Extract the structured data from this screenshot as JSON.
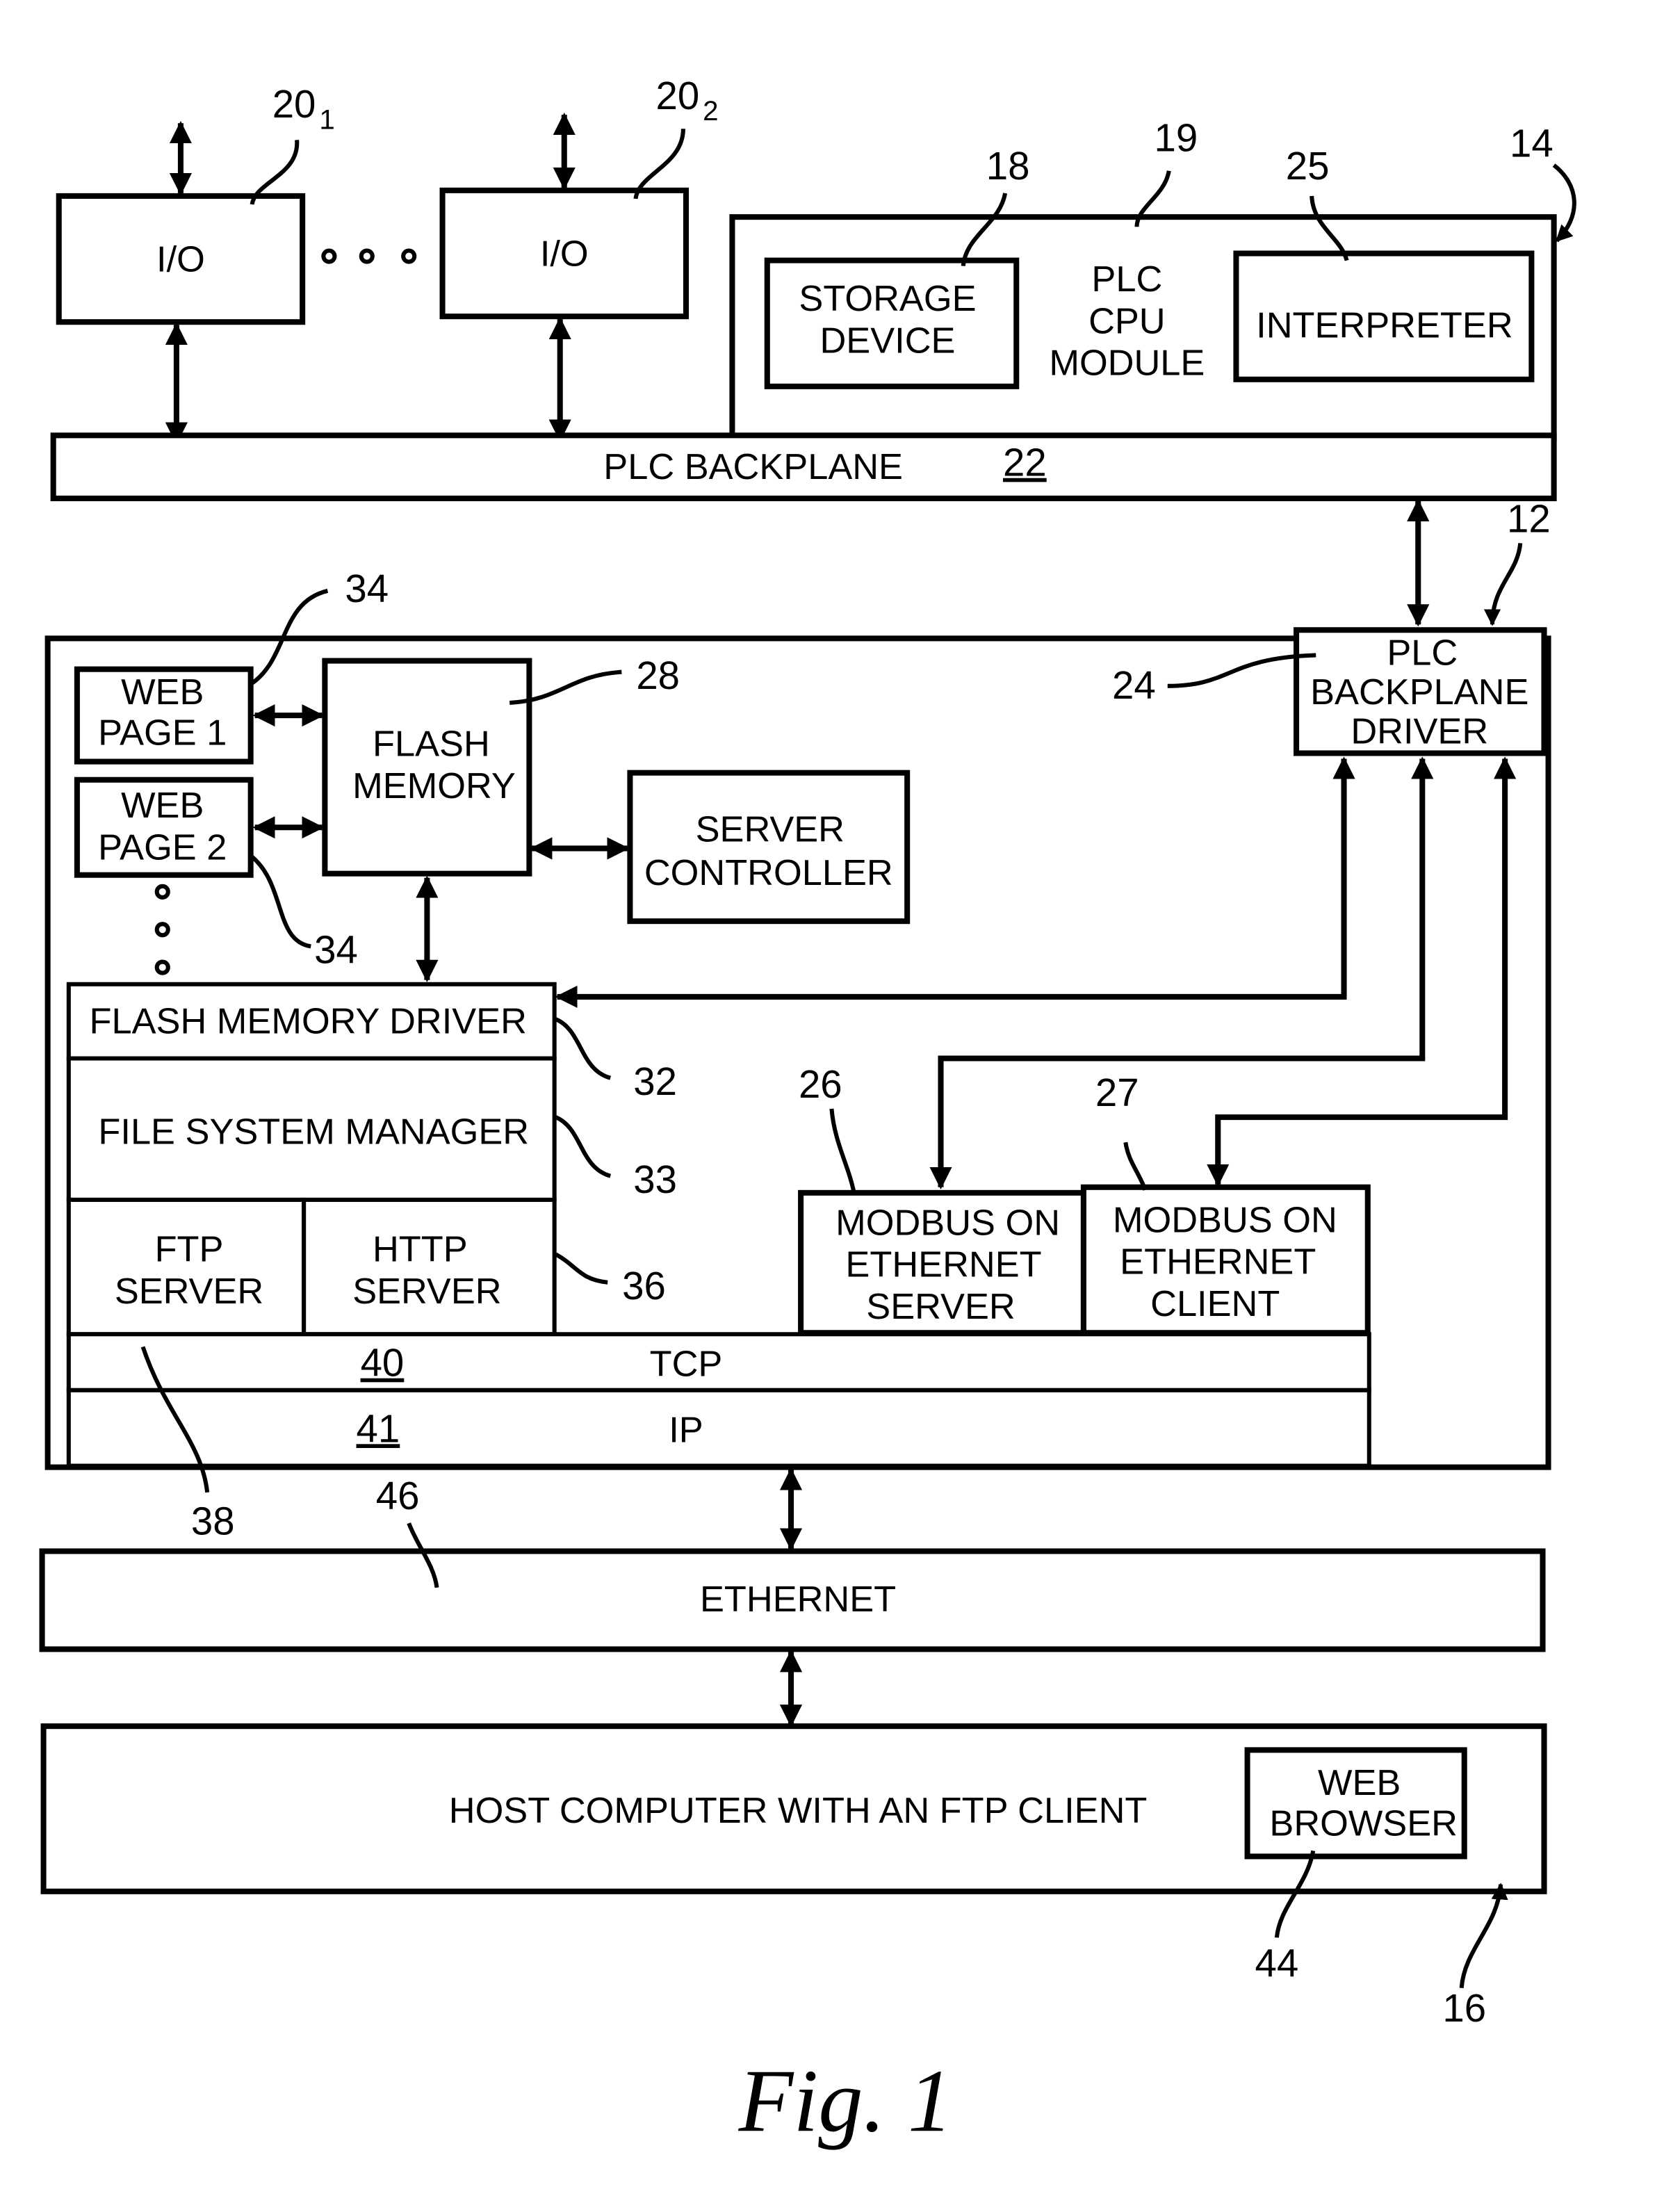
{
  "figure": {
    "caption": "Fig. 1"
  },
  "io_modules": [
    {
      "label": "I/O",
      "ref": "20",
      "sub": "1"
    },
    {
      "label": "I/O",
      "ref": "20",
      "sub": "2"
    }
  ],
  "plc_cpu_module": {
    "ref": "19",
    "label_lines": [
      "PLC",
      "CPU",
      "MODULE"
    ],
    "assembly_ref": "14",
    "storage_device": {
      "label_lines": [
        "STORAGE",
        "DEVICE"
      ],
      "ref": "18"
    },
    "interpreter": {
      "label": "INTERPRETER",
      "ref": "25"
    }
  },
  "plc_backplane": {
    "label": "PLC BACKPLANE",
    "ref": "22"
  },
  "module_12": {
    "ref": "12",
    "plc_backplane_driver": {
      "label_lines": [
        "PLC",
        "BACKPLANE",
        "DRIVER"
      ],
      "ref": "24"
    },
    "web_pages": [
      {
        "label_lines": [
          "WEB",
          "PAGE 1"
        ],
        "ref": "34"
      },
      {
        "label_lines": [
          "WEB",
          "PAGE 2"
        ],
        "ref": "34"
      }
    ],
    "flash_memory": {
      "label_lines": [
        "FLASH",
        "MEMORY"
      ],
      "ref": "28"
    },
    "server_controller": {
      "label_lines": [
        "SERVER",
        "CONTROLLER"
      ]
    },
    "flash_memory_driver": {
      "label": "FLASH MEMORY DRIVER",
      "ref": "32"
    },
    "file_system_manager": {
      "label": "FILE SYSTEM MANAGER",
      "ref": "33"
    },
    "ftp_server": {
      "label_lines": [
        "FTP",
        "SERVER"
      ],
      "ref": "38"
    },
    "http_server": {
      "label_lines": [
        "HTTP",
        "SERVER"
      ]
    },
    "servers_ref": "36",
    "modbus_server": {
      "label_lines": [
        "MODBUS ON",
        "ETHERNET",
        "SERVER"
      ],
      "ref": "26"
    },
    "modbus_client": {
      "label_lines": [
        "MODBUS ON",
        "ETHERNET",
        "CLIENT"
      ],
      "ref": "27"
    },
    "tcp": {
      "label": "TCP",
      "ref": "40"
    },
    "ip": {
      "label": "IP",
      "ref": "41"
    }
  },
  "ethernet": {
    "label": "ETHERNET",
    "ref": "46"
  },
  "host_computer": {
    "label": "HOST COMPUTER WITH AN FTP CLIENT",
    "ref": "16",
    "web_browser": {
      "label_lines": [
        "WEB",
        "BROWSER"
      ],
      "ref": "44"
    }
  }
}
